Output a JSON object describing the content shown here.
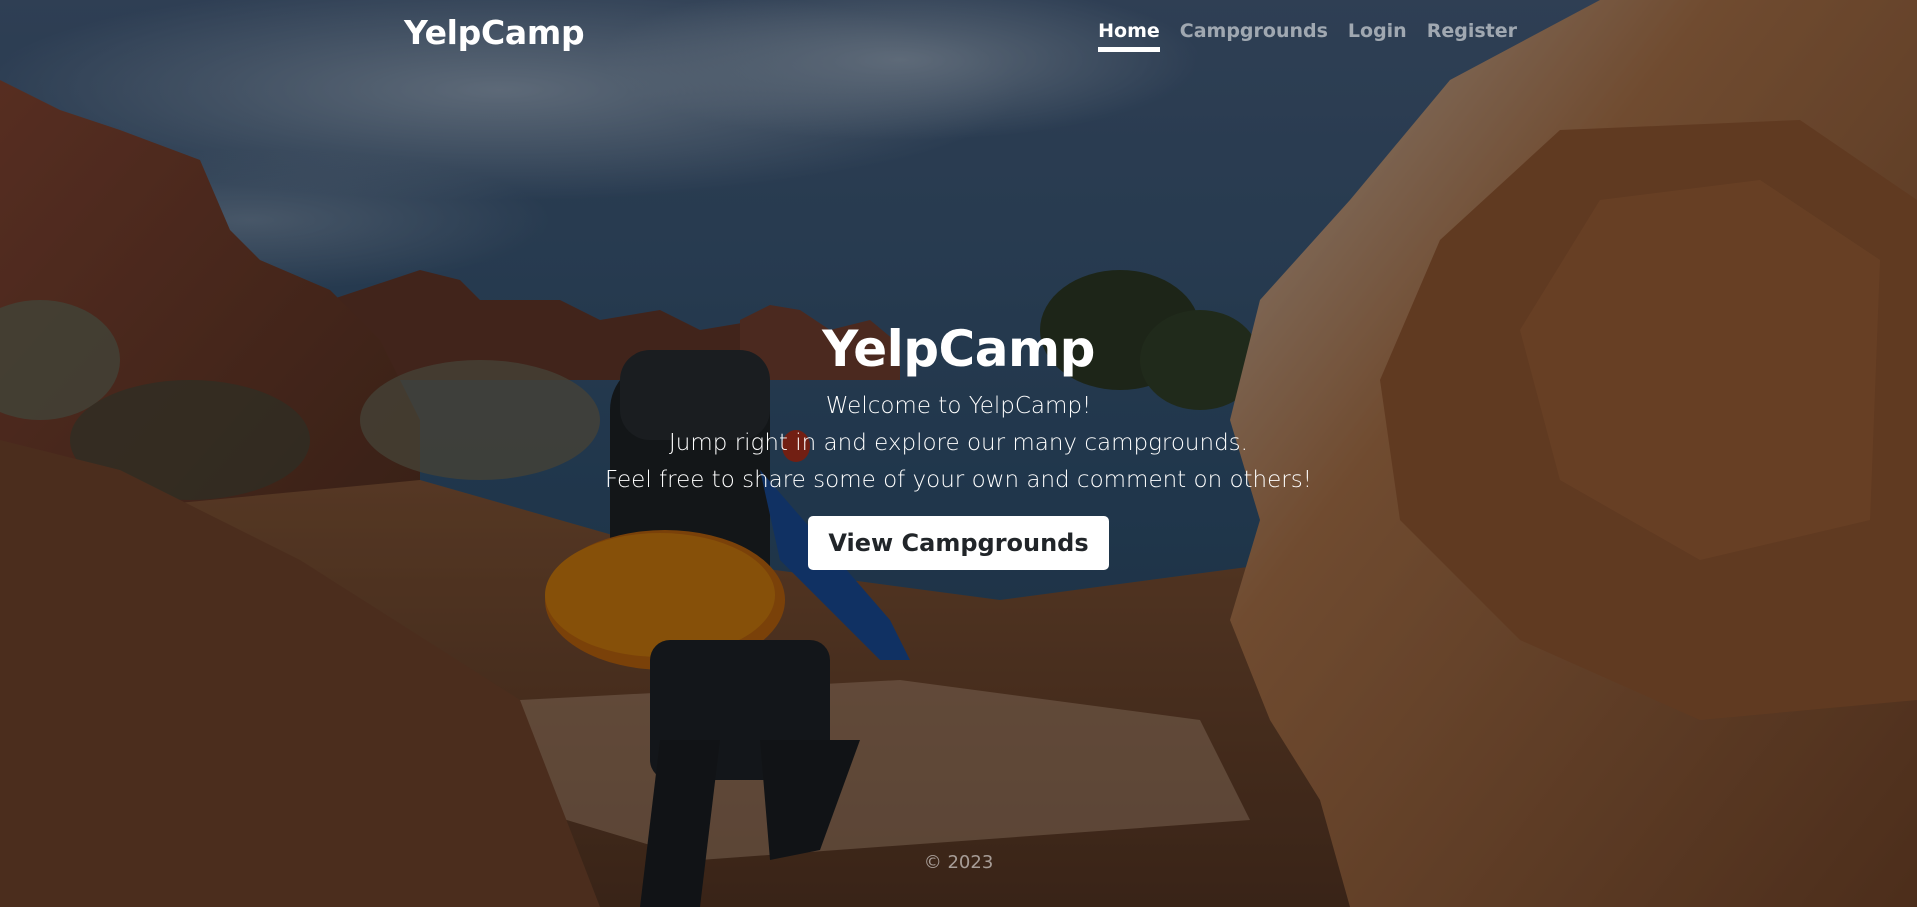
{
  "header": {
    "brand": "YelpCamp",
    "nav": [
      {
        "label": "Home",
        "active": true
      },
      {
        "label": "Campgrounds",
        "active": false
      },
      {
        "label": "Login",
        "active": false
      },
      {
        "label": "Register",
        "active": false
      }
    ]
  },
  "hero": {
    "title": "YelpCamp",
    "lines": [
      "Welcome to YelpCamp!",
      "Jump right in and explore our many campgrounds.",
      "Feel free to share some of your own and comment on others!"
    ],
    "cta_label": "View Campgrounds"
  },
  "footer": {
    "text": "© 2023"
  },
  "background": {
    "description_icon": "hiker-canyon-photo",
    "colors": {
      "sky": "#2c4a66",
      "rock_light": "#b07a52",
      "rock_dark": "#5a3320",
      "ground": "#8a5a38"
    }
  }
}
